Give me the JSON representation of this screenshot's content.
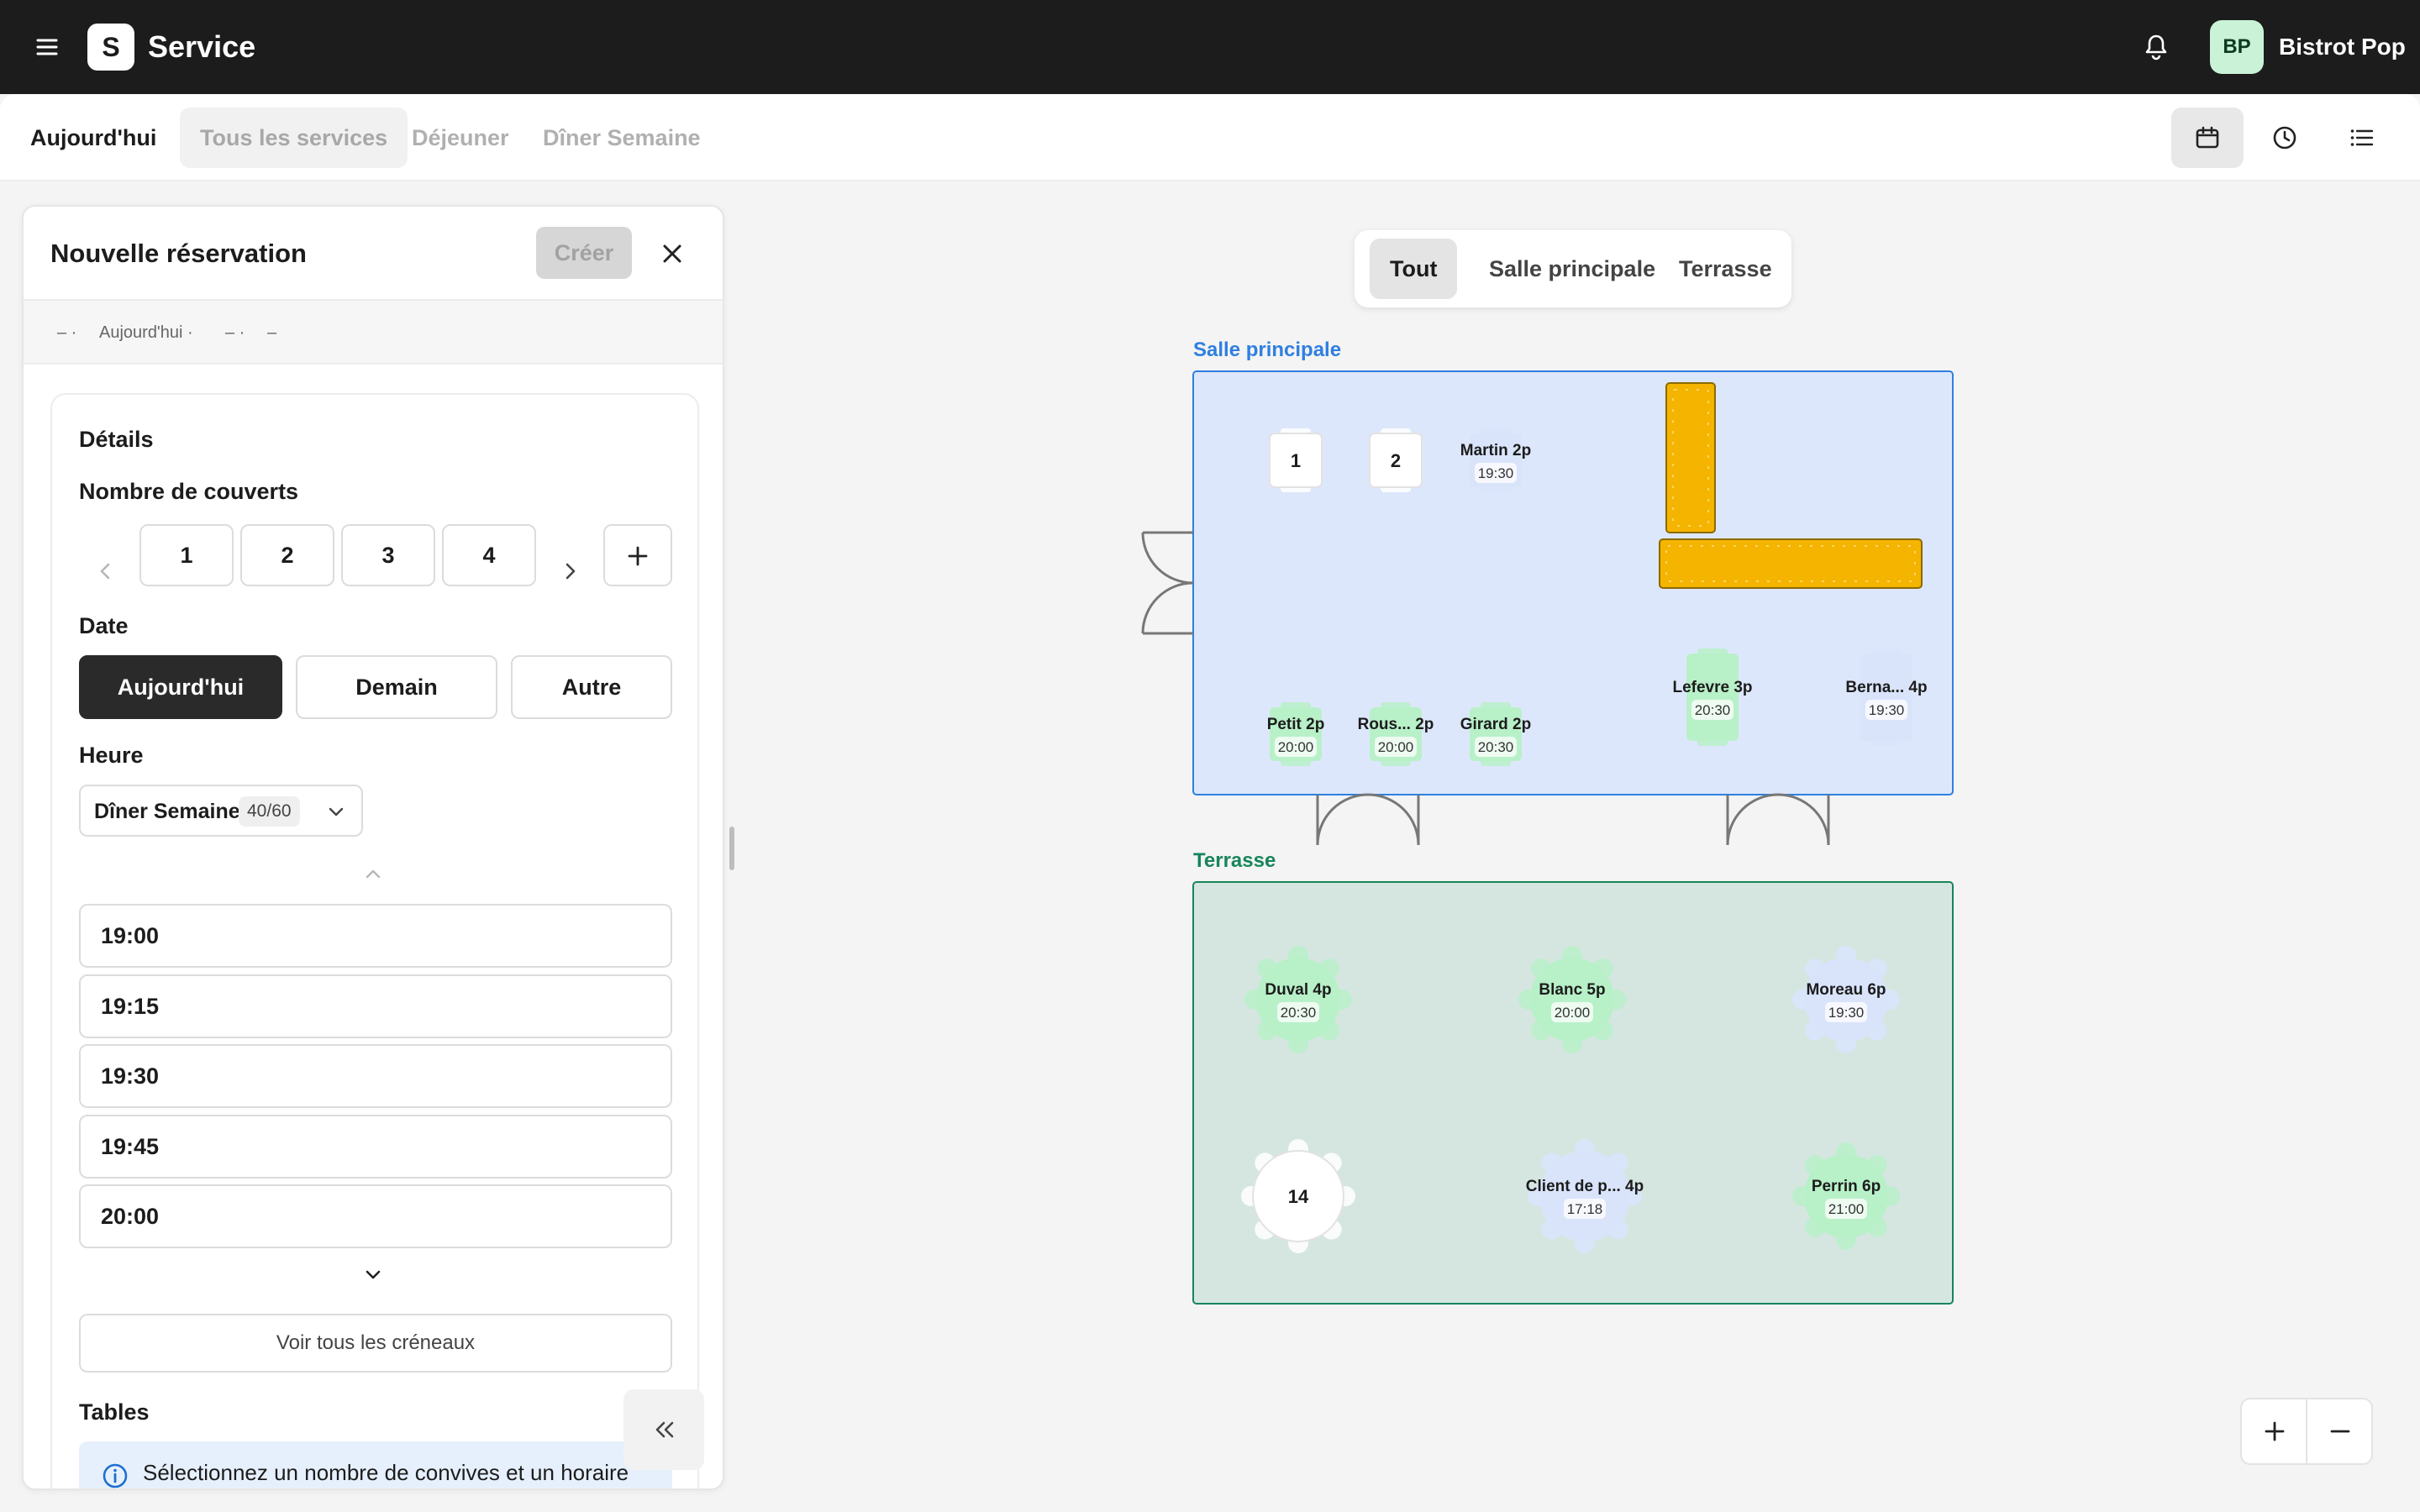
{
  "app": {
    "title": "Service",
    "logo_letter": "S"
  },
  "user": {
    "initials": "BP",
    "restaurant": "Bistrot Pop"
  },
  "services": {
    "today_label": "Aujourd'hui",
    "tabs": [
      "Tous les services",
      "Déjeuner",
      "Dîner Semaine"
    ],
    "active_tab": "Tous les services"
  },
  "views": [
    "calendar-icon",
    "clock-icon",
    "list-icon"
  ],
  "panel": {
    "title": "Nouvelle réservation",
    "create_label": "Créer",
    "summary": [
      "– ·",
      "Aujourd'hui ·",
      "– ·",
      "–"
    ],
    "details_title": "Détails",
    "covers": {
      "label": "Nombre de couverts",
      "options": [
        "1",
        "2",
        "3",
        "4"
      ]
    },
    "date": {
      "label": "Date",
      "options": [
        "Aujourd'hui",
        "Demain",
        "Autre"
      ],
      "selected": "Aujourd'hui"
    },
    "time": {
      "label": "Heure",
      "service_select": "Dîner Semaine",
      "service_capacity": "40/60",
      "slots": [
        "19:00",
        "19:15",
        "19:30",
        "19:45",
        "20:00"
      ],
      "see_all": "Voir tous les créneaux"
    },
    "tables": {
      "label": "Tables",
      "info": "Sélectionnez un nombre de convives et un horaire"
    }
  },
  "floorplan": {
    "filters": [
      "Tout",
      "Salle principale",
      "Terrasse"
    ],
    "active_filter": "Tout",
    "zones": [
      {
        "name": "Salle principale",
        "color": "#2f7fe0",
        "fill": "#dde7fb"
      },
      {
        "name": "Terrasse",
        "color": "#17855a",
        "fill": "#d5e6e1"
      }
    ],
    "tables": [
      {
        "zone": "Salle principale",
        "label": "1",
        "time": "",
        "status": "free"
      },
      {
        "zone": "Salle principale",
        "label": "2",
        "time": "",
        "status": "free"
      },
      {
        "zone": "Salle principale",
        "label": "Martin 2p",
        "time": "19:30",
        "status": "booked"
      },
      {
        "zone": "Salle principale",
        "label": "Petit 2p",
        "time": "20:00",
        "status": "seated"
      },
      {
        "zone": "Salle principale",
        "label": "Rous... 2p",
        "time": "20:00",
        "status": "seated"
      },
      {
        "zone": "Salle principale",
        "label": "Girard 2p",
        "time": "20:30",
        "status": "seated"
      },
      {
        "zone": "Salle principale",
        "label": "Lefevre 3p",
        "time": "20:30",
        "status": "seated"
      },
      {
        "zone": "Salle principale",
        "label": "Berna... 4p",
        "time": "19:30",
        "status": "booked"
      },
      {
        "zone": "Terrasse",
        "label": "Duval 4p",
        "time": "20:30",
        "status": "seated"
      },
      {
        "zone": "Terrasse",
        "label": "Blanc 5p",
        "time": "20:00",
        "status": "seated"
      },
      {
        "zone": "Terrasse",
        "label": "Moreau 6p",
        "time": "19:30",
        "status": "booked"
      },
      {
        "zone": "Terrasse",
        "label": "14",
        "time": "",
        "status": "free"
      },
      {
        "zone": "Terrasse",
        "label": "Client de p... 4p",
        "time": "17:18",
        "status": "booked"
      },
      {
        "zone": "Terrasse",
        "label": "Perrin 6p",
        "time": "21:00",
        "status": "seated"
      }
    ],
    "status_colors": {
      "free": "#ffffff",
      "seated": "#b8f0c8",
      "booked": "#d9e4fb"
    },
    "bar_color": "#f4b400"
  },
  "zoom": {
    "in": "+",
    "out": "−"
  }
}
